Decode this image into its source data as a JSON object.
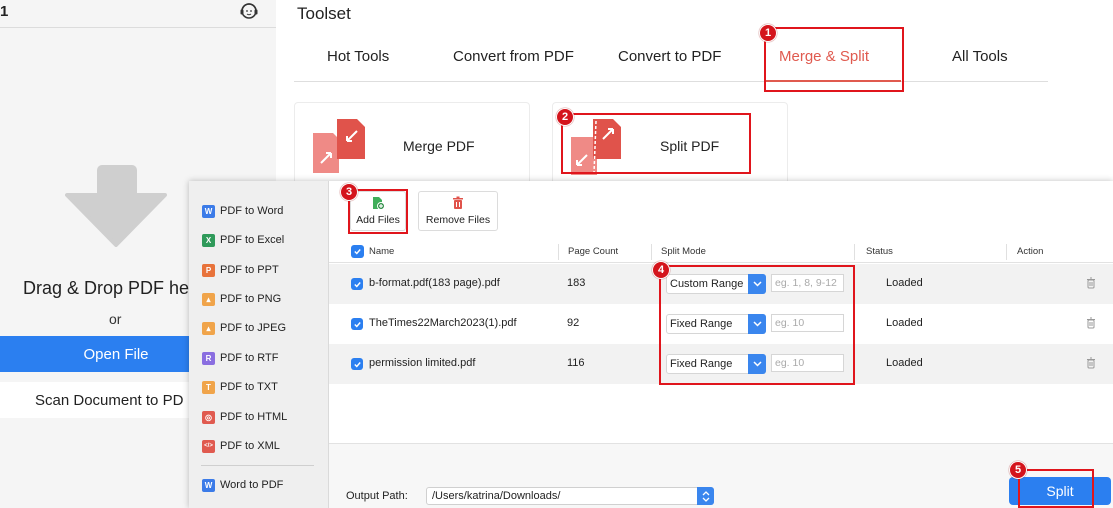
{
  "left_panel": {
    "top_number": "1",
    "drag_text": "Drag & Drop PDF he",
    "or_text": "or",
    "open_file_label": "Open File",
    "scan_label": "Scan Document to PD"
  },
  "toolset": {
    "title": "Toolset",
    "tabs": [
      {
        "label": "Hot Tools"
      },
      {
        "label": "Convert from PDF"
      },
      {
        "label": "Convert to PDF"
      },
      {
        "label": "Merge & Split"
      },
      {
        "label": "All Tools"
      }
    ],
    "active_tab": "Merge & Split",
    "cards": [
      {
        "label": "Merge PDF"
      },
      {
        "label": "Split PDF"
      }
    ]
  },
  "dialog": {
    "sidebar": [
      {
        "label": "PDF to Word",
        "icon_char": "W",
        "color": "#3b7be8"
      },
      {
        "label": "PDF to Excel",
        "icon_char": "X",
        "color": "#2f9a5a"
      },
      {
        "label": "PDF to PPT",
        "icon_char": "P",
        "color": "#e8733b"
      },
      {
        "label": "PDF to PNG",
        "icon_char": "▪",
        "color": "#f0a44a"
      },
      {
        "label": "PDF to JPEG",
        "icon_char": "▪",
        "color": "#f0a44a"
      },
      {
        "label": "PDF to RTF",
        "icon_char": "R",
        "color": "#8a6ee0"
      },
      {
        "label": "PDF to TXT",
        "icon_char": "T",
        "color": "#f0a44a"
      },
      {
        "label": "PDF to HTML",
        "icon_char": "◎",
        "color": "#e05a4f"
      },
      {
        "label": "PDF to XML",
        "icon_char": "</>",
        "color": "#e05a4f"
      },
      {
        "label": "Word to PDF",
        "icon_char": "W",
        "color": "#3b7be8"
      }
    ],
    "toolbar": {
      "add_files": "Add Files",
      "remove_files": "Remove Files"
    },
    "table": {
      "headers": {
        "name": "Name",
        "page_count": "Page Count",
        "split_mode": "Split Mode",
        "status": "Status",
        "action": "Action"
      },
      "rows": [
        {
          "name": "b-format.pdf(183 page).pdf",
          "page_count": "183",
          "split_mode": "Custom Range",
          "range_placeholder": "eg. 1, 8, 9-12",
          "status": "Loaded"
        },
        {
          "name": "TheTimes22March2023(1).pdf",
          "page_count": "92",
          "split_mode": "Fixed Range",
          "range_placeholder": "eg. 10",
          "status": "Loaded"
        },
        {
          "name": "permission limited.pdf",
          "page_count": "116",
          "split_mode": "Fixed Range",
          "range_placeholder": "eg. 10",
          "status": "Loaded"
        }
      ]
    },
    "output_label": "Output Path:",
    "output_path": "/Users/katrina/Downloads/",
    "split_button": "Split"
  },
  "annotations": [
    "1",
    "2",
    "3",
    "4",
    "5"
  ],
  "colors": {
    "accent_blue": "#2b7ff0",
    "active_tab_red": "#e05a4f",
    "highlight_red": "#e0151c"
  }
}
